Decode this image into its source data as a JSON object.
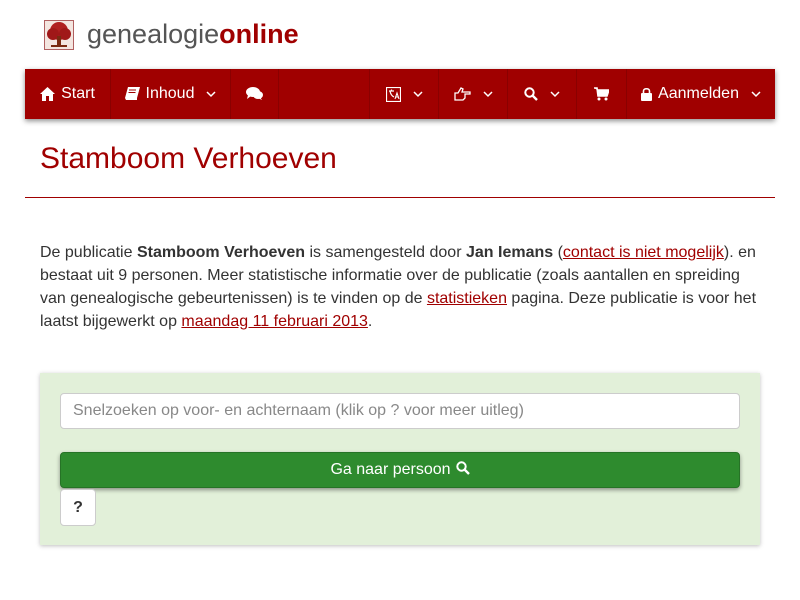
{
  "site": {
    "logo_plain": "genealogie",
    "logo_bold": "online",
    "logo_icon": "tree-icon"
  },
  "navbar": {
    "start_label": "Start",
    "inhoud_label": "Inhoud",
    "login_label": "Aanmelden",
    "icons": [
      "home-icon",
      "book-icon",
      "comments-icon",
      "translate-icon",
      "hand-point-icon",
      "search-icon",
      "cart-icon",
      "lock-icon"
    ]
  },
  "main": {
    "title": "Stamboom Verhoeven",
    "intro": {
      "p1": "De publicatie ",
      "publication": "Stamboom Verhoeven",
      "p2": " is samengesteld door ",
      "author": "Jan Iemans",
      "p3": " (",
      "contact_link": "contact is niet mogelijk",
      "p4": "). en bestaat uit 9 personen. Meer statistische informatie over de publicatie (zoals aantallen en spreiding van genealogische gebeurtenissen) is te vinden op de ",
      "stats_link": "statistieken",
      "p5": " pagina. Deze publicatie is voor het laatst bijgewerkt op ",
      "date_link": "maandag 11 februari 2013",
      "p6": "."
    }
  },
  "search": {
    "placeholder": "Snelzoeken op voor- en achternaam (klik op ? voor meer uitleg)",
    "value": "",
    "go_label": "Ga naar persoon",
    "help_label": "?"
  },
  "colors": {
    "brand": "#a00000",
    "panel_bg": "#e2f0d9",
    "button_green": "#2e8b2e"
  }
}
